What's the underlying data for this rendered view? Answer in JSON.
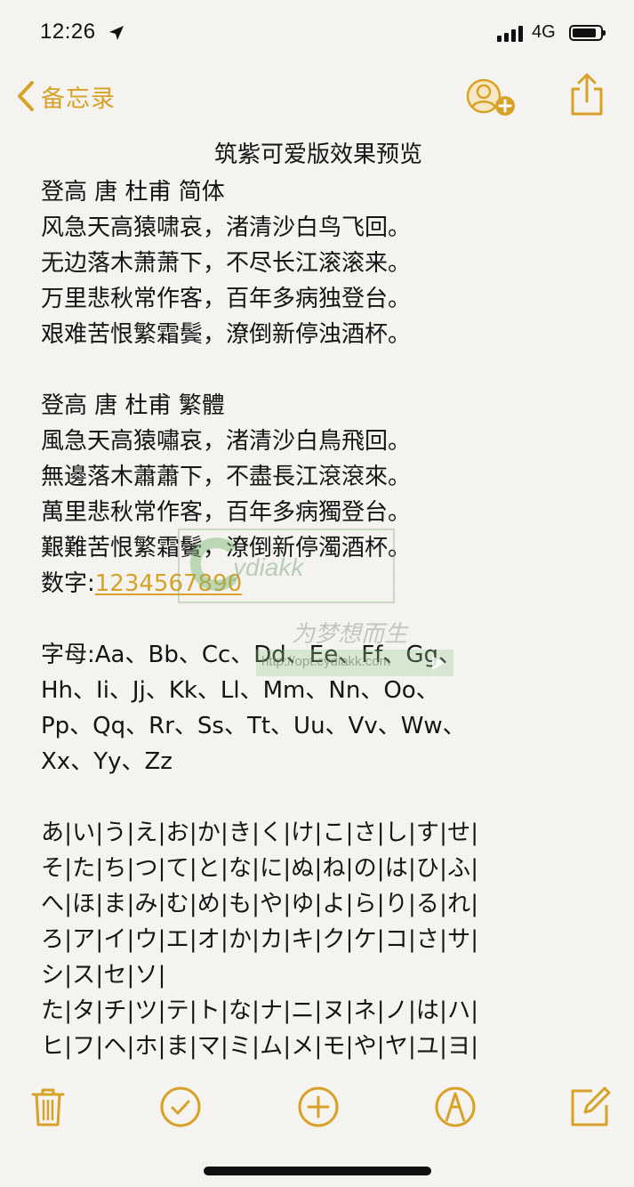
{
  "status_bar": {
    "time": "12:26",
    "network": "4G"
  },
  "nav": {
    "back_label": "备忘录"
  },
  "note": {
    "title": "筑紫可爱版效果预览",
    "lines": [
      "登高 唐 杜甫 简体",
      "风急天高猿啸哀，渚清沙白鸟飞回。",
      "无边落木萧萧下，不尽长江滚滚来。",
      "万里悲秋常作客，百年多病独登台。",
      "艰难苦恨繁霜鬓，潦倒新停浊酒杯。",
      "",
      "登高 唐 杜甫 繁體",
      "風急天高猿嘯哀，渚清沙白鳥飛回。",
      "無邊落木蕭蕭下，不盡長江滾滾來。",
      "萬里悲秋常作客，百年多病獨登台。",
      "艱難苦恨繁霜鬢，潦倒新停濁酒杯。"
    ],
    "numbers_label": "数字:",
    "numbers_value": "1234567890",
    "letters_lines": [
      "字母:Aa、Bb、Cc、Dd、Ee、Ff、Gg、",
      "Hh、Ii、Jj、Kk、Ll、Mm、Nn、Oo、",
      "Pp、Qq、Rr、Ss、Tt、Uu、Vv、Ww、",
      "Xx、Yy、Zz"
    ],
    "kana_lines": [
      "あ|い|う|え|お|か|き|く|け|こ|さ|し|す|せ|",
      "そ|た|ち|つ|て|と|な|に|ぬ|ね|の|は|ひ|ふ|",
      "へ|ほ|ま|み|む|め|も|や|ゆ|よ|ら|り|る|れ|",
      "ろ|ア|イ|ウ|エ|オ|か|カ|キ|ク|ケ|コ|さ|サ|",
      "シ|ス|セ|ソ|",
      "た|タ|チ|ツ|テ|ト|な|ナ|ニ|ヌ|ネ|ノ|は|ハ|",
      "ヒ|フ|ヘ|ホ|ま|マ|ミ|ム|メ|モ|や|ヤ|ユ|ヨ|"
    ]
  },
  "watermark": {
    "brand": "ydiakk",
    "url": "http://opt.cydiakk.com",
    "slogan": "为梦想而生"
  },
  "toolbar": {
    "items": [
      "trash-icon",
      "checklist-icon",
      "add-icon",
      "markup-icon",
      "compose-icon"
    ]
  },
  "colors": {
    "accent": "#d8a127",
    "text": "#151515",
    "background": "#f6f5f2"
  }
}
